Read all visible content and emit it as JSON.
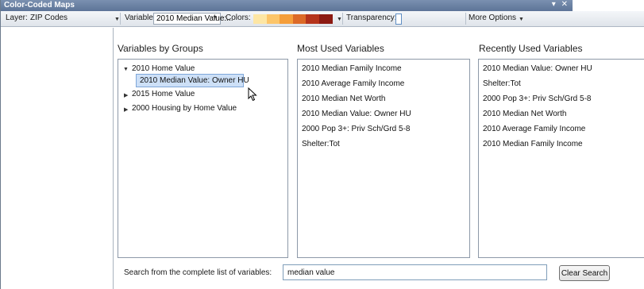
{
  "window": {
    "title": "Color-Coded Maps",
    "controls": [
      "▾",
      "✕"
    ]
  },
  "toolbar": {
    "layer_label": "Layer:",
    "layer_value": "ZIP Codes",
    "variable_label": "Variable:",
    "variable_value": "2010 Median Value:...",
    "colors_label": "Colors:",
    "color_ramp": [
      "#fde6a4",
      "#fcc569",
      "#f59e3a",
      "#dc6a28",
      "#b5341c",
      "#8c1a12"
    ],
    "transparency_label": "Transparency:",
    "more_options_label": "More Options"
  },
  "groups": {
    "header": "Variables by Groups",
    "items": [
      {
        "label": "2010 Home Value",
        "expanded": true
      },
      {
        "label": "2010 Median Value: Owner HU",
        "selected": true
      },
      {
        "label": "2015 Home Value",
        "expanded": false
      },
      {
        "label": "2000 Housing by Home Value",
        "expanded": false
      }
    ]
  },
  "most_used": {
    "header": "Most Used Variables",
    "items": [
      "2010 Median Family Income",
      "2010 Average Family Income",
      "2010 Median Net Worth",
      "2010 Median Value: Owner HU",
      "2000 Pop 3+: Priv Sch/Grd 5-8",
      "Shelter:Tot"
    ]
  },
  "recently_used": {
    "header": "Recently Used Variables",
    "items": [
      "2010 Median Value: Owner HU",
      "Shelter:Tot",
      "2000 Pop 3+: Priv Sch/Grd 5-8",
      "2010 Median Net Worth",
      "2010 Average Family Income",
      "2010 Median Family Income"
    ]
  },
  "search": {
    "label": "Search from the complete list of variables:",
    "value": "median value",
    "clear_label": "Clear Search"
  }
}
